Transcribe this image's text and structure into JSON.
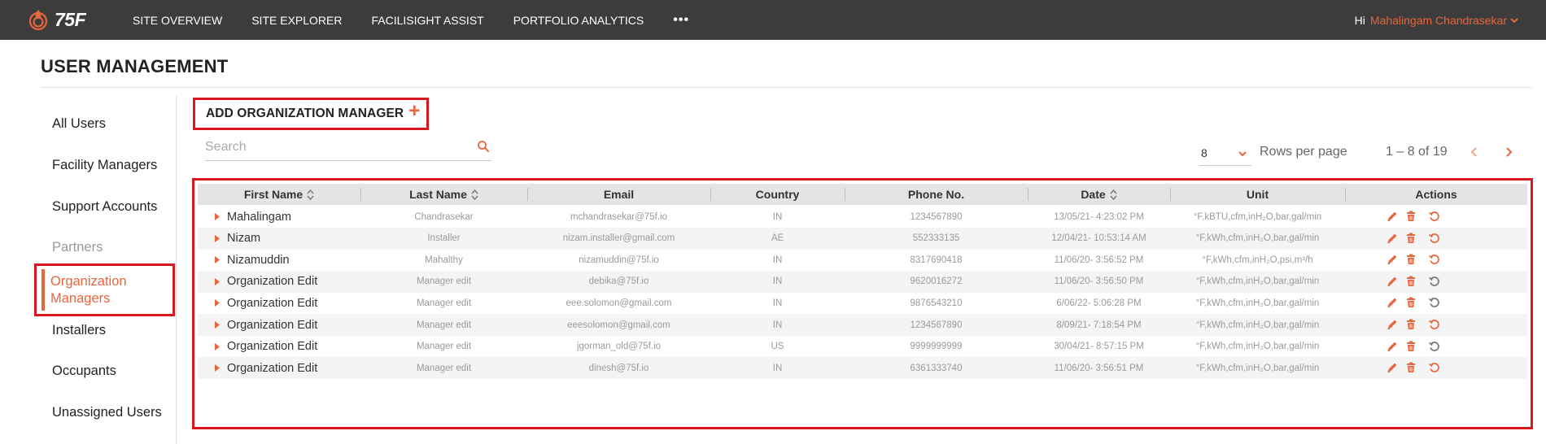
{
  "brand": {
    "logo_text": "75F",
    "accent": "#e8663d",
    "highlight": "#d7191f"
  },
  "nav": {
    "items": [
      "SITE OVERVIEW",
      "SITE EXPLORER",
      "FACILISIGHT ASSIST",
      "PORTFOLIO ANALYTICS"
    ],
    "more": "•••"
  },
  "user": {
    "greeting": "Hi",
    "name": "Mahalingam Chandrasekar"
  },
  "page": {
    "title": "USER MANAGEMENT"
  },
  "sidebar": {
    "items": [
      {
        "label": "All Users"
      },
      {
        "label": "Facility Managers"
      },
      {
        "label": "Support Accounts"
      },
      {
        "label": "Partners"
      },
      {
        "label": "Organization Managers",
        "line1": "Organization",
        "line2": "Managers",
        "active": true
      },
      {
        "label": "Installers"
      },
      {
        "label": "Occupants"
      },
      {
        "label": "Unassigned Users"
      }
    ]
  },
  "toolbar": {
    "add_label": "ADD ORGANIZATION MANAGER",
    "add_icon": "plus-icon"
  },
  "search": {
    "placeholder": "Search",
    "value": ""
  },
  "pagination": {
    "rows_per_page_value": "8",
    "rows_per_page_label": "Rows per page",
    "range": "1 – 8 of 19"
  },
  "table": {
    "columns": [
      "First Name",
      "Last Name",
      "Email",
      "Country",
      "Phone No.",
      "Date",
      "Unit",
      "Actions"
    ],
    "rows": [
      {
        "first": "Mahalingam",
        "last": "Chandrasekar",
        "email": "mchandrasekar@75f.io",
        "country": "IN",
        "phone": "1234567890",
        "date": "13/05/21- 4:23:02 PM",
        "unit": "°F,kBTU,cfm,inH₂O,bar,gal/min"
      },
      {
        "first": "Nizam",
        "last": "Installer",
        "email": "nizam.installer@gmail.com",
        "country": "AE",
        "phone": "552333135",
        "date": "12/04/21- 10:53:14 AM",
        "unit": "°F,kWh,cfm,inH₂O,bar,gal/min"
      },
      {
        "first": "Nizamuddin",
        "last": "Mahalthy",
        "email": "nizamuddin@75f.io",
        "country": "IN",
        "phone": "8317690418",
        "date": "11/06/20- 3:56:52 PM",
        "unit": "°F,kWh,cfm,inH₂O,psi,m³/h"
      },
      {
        "first": "Organization Edit",
        "last": "Manager edit",
        "email": "debika@75f.io",
        "country": "IN",
        "phone": "9620016272",
        "date": "11/06/20- 3:56:50 PM",
        "unit": "°F,kWh,cfm,inH₂O,bar,gal/min"
      },
      {
        "first": "Organization Edit",
        "last": "Manager edit",
        "email": "eee.solomon@gmail.com",
        "country": "IN",
        "phone": "9876543210",
        "date": "6/06/22- 5:06:28 PM",
        "unit": "°F,kWh,cfm,inH₂O,bar,gal/min"
      },
      {
        "first": "Organization Edit",
        "last": "Manager edit",
        "email": "eeesolomon@gmail.com",
        "country": "IN",
        "phone": "1234567890",
        "date": "8/09/21- 7:18:54 PM",
        "unit": "°F,kWh,cfm,inH₂O,bar,gal/min"
      },
      {
        "first": "Organization Edit",
        "last": "Manager edit",
        "email": "jgorman_old@75f.io",
        "country": "US",
        "phone": "9999999999",
        "date": "30/04/21- 8:57:15 PM",
        "unit": "°F,kWh,cfm,inH₂O,bar,gal/min"
      },
      {
        "first": "Organization Edit",
        "last": "Manager edit",
        "email": "dinesh@75f.io",
        "country": "IN",
        "phone": "6361333740",
        "date": "11/06/20- 3:56:51 PM",
        "unit": "°F,kWh,cfm,inH₂O,bar,gal/min"
      }
    ],
    "reset_active": [
      true,
      true,
      true,
      false,
      false,
      true,
      false,
      true
    ]
  }
}
